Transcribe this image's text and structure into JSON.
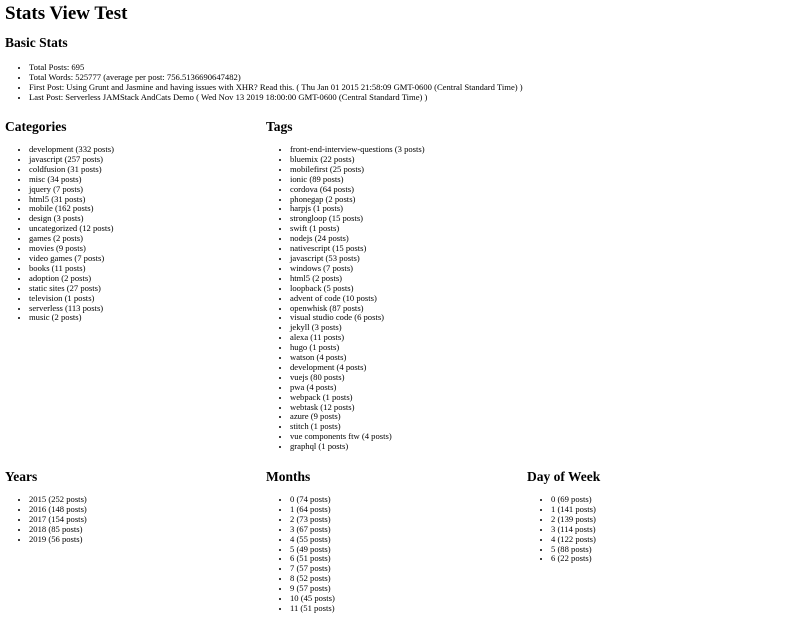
{
  "page_title": "Stats View Test",
  "basic_stats": {
    "heading": "Basic Stats",
    "items": [
      "Total Posts: 695",
      "Total Words: 525777 (average per post: 756.5136690647482)",
      "First Post: Using Grunt and Jasmine and having issues with XHR? Read this. ( Thu Jan 01 2015 21:58:09 GMT-0600 (Central Standard Time) )",
      "Last Post: Serverless JAMStack AndCats Demo ( Wed Nov 13 2019 18:00:00 GMT-0600 (Central Standard Time) )"
    ]
  },
  "categories": {
    "heading": "Categories",
    "items": [
      "development (332 posts)",
      "javascript (257 posts)",
      "coldfusion (31 posts)",
      "misc (34 posts)",
      "jquery (7 posts)",
      "html5 (31 posts)",
      "mobile (162 posts)",
      "design (3 posts)",
      "uncategorized (12 posts)",
      "games (2 posts)",
      "movies (9 posts)",
      "video games (7 posts)",
      "books (11 posts)",
      "adoption (2 posts)",
      "static sites (27 posts)",
      "television (1 posts)",
      "serverless (113 posts)",
      "music (2 posts)"
    ]
  },
  "tags": {
    "heading": "Tags",
    "items": [
      "front-end-interview-questions (3 posts)",
      "bluemix (22 posts)",
      "mobilefirst (25 posts)",
      "ionic (89 posts)",
      "cordova (64 posts)",
      "phonegap (2 posts)",
      "harpjs (1 posts)",
      "strongloop (15 posts)",
      "swift (1 posts)",
      "nodejs (24 posts)",
      "nativescript (15 posts)",
      "javascript (53 posts)",
      "windows (7 posts)",
      "html5 (2 posts)",
      "loopback (5 posts)",
      "advent of code (10 posts)",
      "openwhisk (87 posts)",
      "visual studio code (6 posts)",
      "jekyll (3 posts)",
      "alexa (11 posts)",
      "hugo (1 posts)",
      "watson (4 posts)",
      "development (4 posts)",
      "vuejs (80 posts)",
      "pwa (4 posts)",
      "webpack (1 posts)",
      "webtask (12 posts)",
      "azure (9 posts)",
      "stitch (1 posts)",
      "vue components ftw (4 posts)",
      "graphql (1 posts)"
    ]
  },
  "years": {
    "heading": "Years",
    "items": [
      "2015 (252 posts)",
      "2016 (148 posts)",
      "2017 (154 posts)",
      "2018 (85 posts)",
      "2019 (56 posts)"
    ]
  },
  "months": {
    "heading": "Months",
    "items": [
      "0 (74 posts)",
      "1 (64 posts)",
      "2 (73 posts)",
      "3 (67 posts)",
      "4 (55 posts)",
      "5 (49 posts)",
      "6 (51 posts)",
      "7 (57 posts)",
      "8 (52 posts)",
      "9 (57 posts)",
      "10 (45 posts)",
      "11 (51 posts)"
    ]
  },
  "day_of_week": {
    "heading": "Day of Week",
    "items": [
      "0 (69 posts)",
      "1 (141 posts)",
      "2 (139 posts)",
      "3 (114 posts)",
      "4 (122 posts)",
      "5 (88 posts)",
      "6 (22 posts)"
    ]
  }
}
